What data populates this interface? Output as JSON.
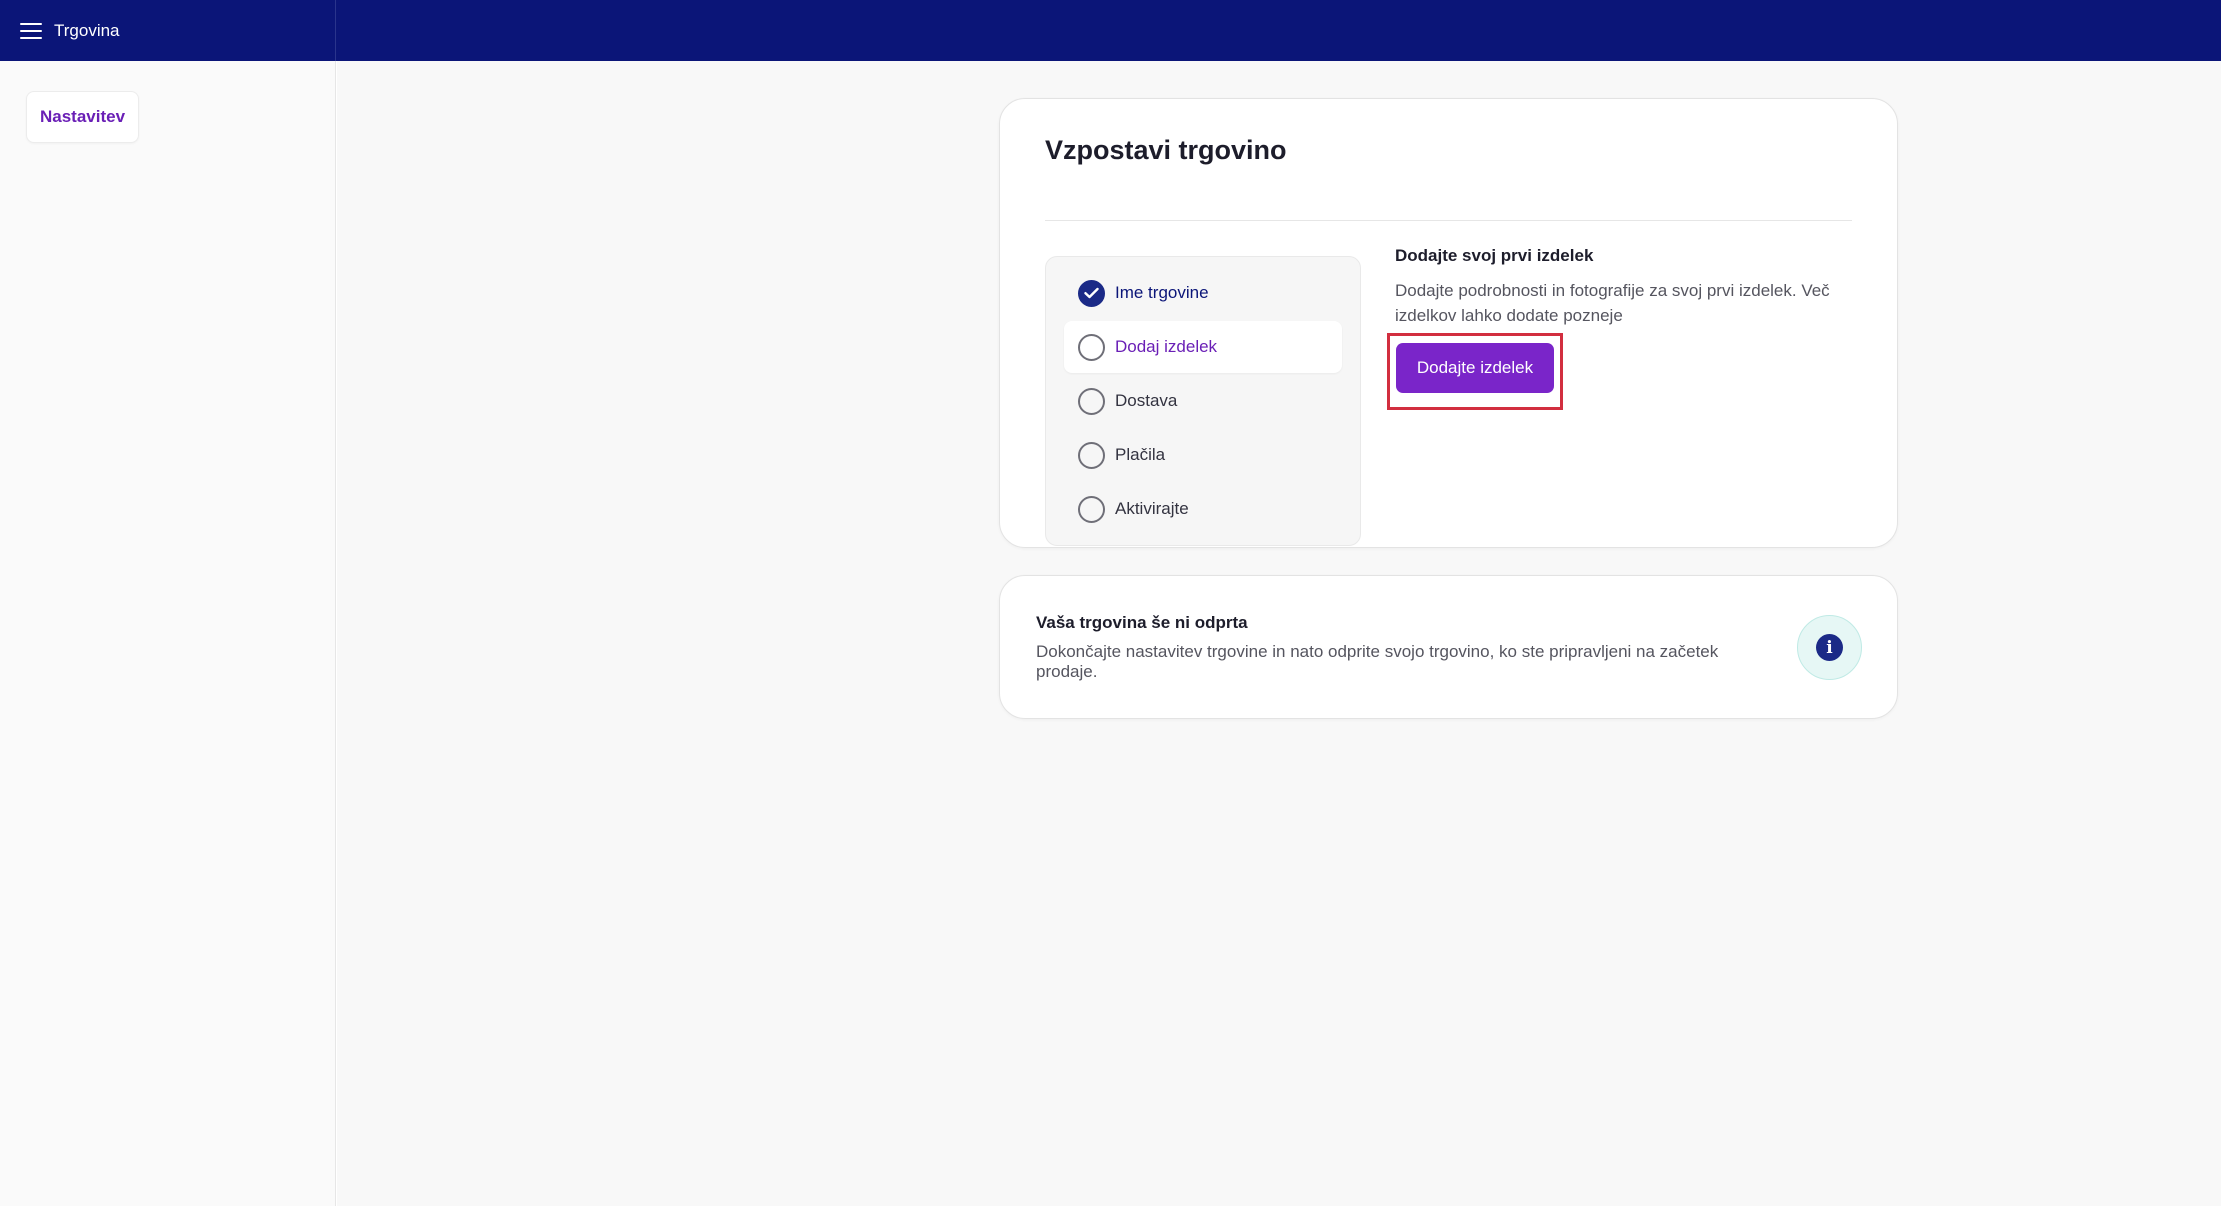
{
  "header": {
    "menu_icon": "hamburger-menu-icon",
    "app_title": "Trgovina"
  },
  "sidebar": {
    "items": [
      {
        "label": "Nastavitev",
        "active": true
      }
    ]
  },
  "setup": {
    "title": "Vzpostavi trgovino",
    "steps": [
      {
        "label": "Ime trgovine",
        "state": "done",
        "icon": "check-circle-icon"
      },
      {
        "label": "Dodaj izdelek",
        "state": "active",
        "icon": "circle-icon"
      },
      {
        "label": "Dostava",
        "state": "todo",
        "icon": "circle-icon"
      },
      {
        "label": "Plačila",
        "state": "todo",
        "icon": "circle-icon"
      },
      {
        "label": "Aktivirajte",
        "state": "todo",
        "icon": "circle-icon"
      }
    ],
    "detail": {
      "heading": "Dodajte svoj prvi izdelek",
      "text": "Dodajte podrobnosti in fotografije za svoj prvi izdelek. Več izdelkov lahko dodate pozneje",
      "button_label": "Dodajte izdelek"
    }
  },
  "status": {
    "title": "Vaša trgovina še ni odprta",
    "text": "Dokončajte nastavitev trgovine in nato odprite svojo trgovino, ko ste pripravljeni na začetek prodaje.",
    "icon": "info-icon",
    "icon_glyph": "i"
  },
  "colors": {
    "topbar": "#0b1578",
    "accent": "#7a25c9",
    "active_text": "#6a1fb6",
    "done": "#1b2a87",
    "highlight_border": "#d22e3f"
  }
}
